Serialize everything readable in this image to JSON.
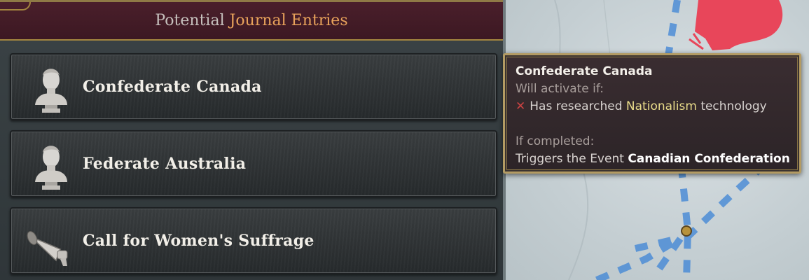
{
  "header": {
    "title_prefix": "Potential",
    "title_highlight": "Journal Entries"
  },
  "entries": [
    {
      "label": "Confederate Canada",
      "icon": "bust-statue-icon"
    },
    {
      "label": "Federate Australia",
      "icon": "bust-statue-icon"
    },
    {
      "label": "Call for Women's Suffrage",
      "icon": "megaphone-icon"
    }
  ],
  "tooltip": {
    "title": "Confederate Canada",
    "condition_heading": "Will activate if:",
    "requirement_prefix": "Has researched",
    "requirement_highlight": "Nationalism",
    "requirement_suffix": "technology",
    "completion_heading": "If completed:",
    "effect_prefix": "Triggers the Event",
    "effect_highlight": "Canadian Confederation",
    "fail_icon": "cross-icon"
  },
  "colors": {
    "header_bg": "#4a1f2b",
    "header_highlight": "#e8a25b",
    "tooltip_border": "#b39b63",
    "highlight_yellow": "#e9dc8a",
    "fail_red": "#c94242",
    "map_land": "#e8465a",
    "map_route": "#4d8dd6"
  }
}
